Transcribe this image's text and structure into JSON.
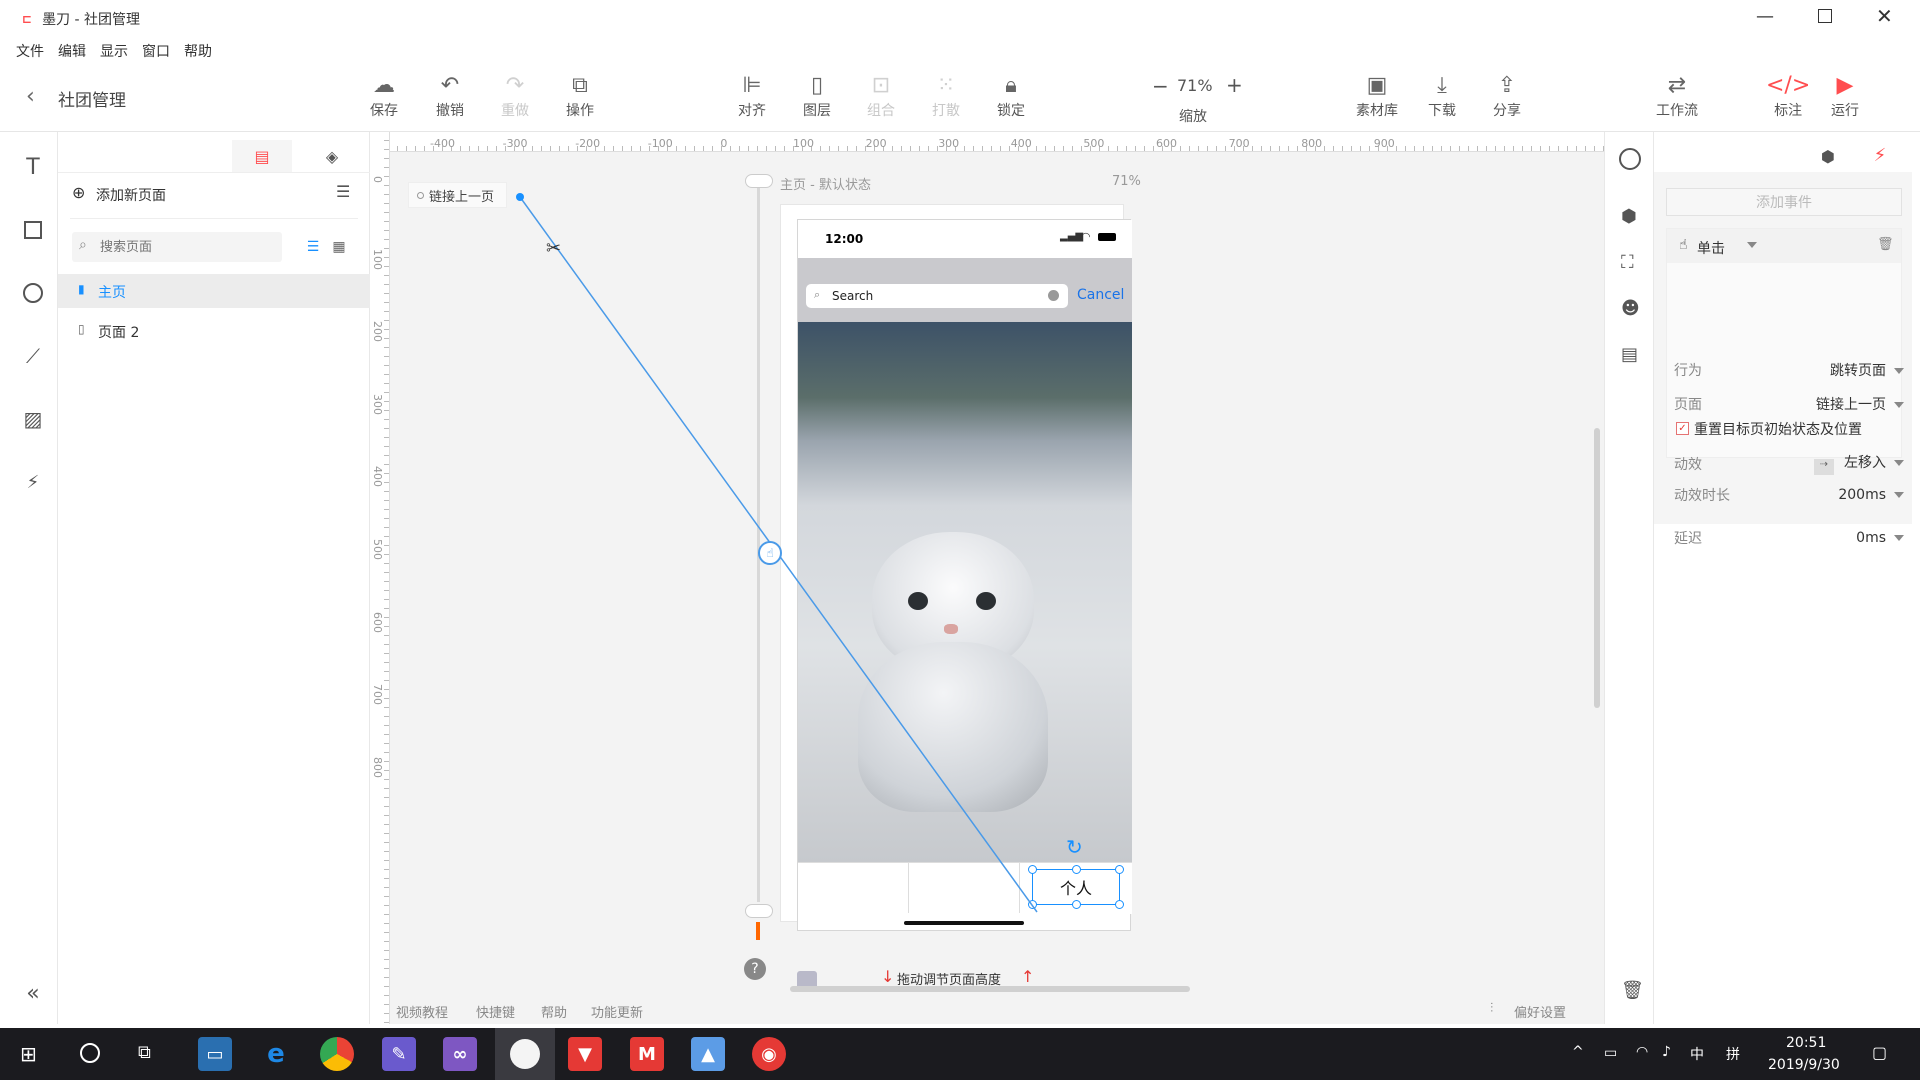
{
  "app": {
    "window_title": "墨刀 - 社团管理",
    "back_label": "社团管理"
  },
  "menu": [
    "文件",
    "编辑",
    "显示",
    "窗口",
    "帮助"
  ],
  "toolbar": {
    "save": "保存",
    "undo": "撤销",
    "redo": "重做",
    "ops": "操作",
    "align": "对齐",
    "layer": "图层",
    "group": "组合",
    "ungroup": "打散",
    "lock": "锁定",
    "zoom_value": "71%",
    "zoom_label": "缩放",
    "zoom_minus": "−",
    "zoom_plus": "+",
    "assets": "素材库",
    "download": "下载",
    "share": "分享",
    "workflow": "工作流",
    "annotate": "标注",
    "run": "运行"
  },
  "pages": {
    "add_label": "添加新页面",
    "search_placeholder": "搜索页面",
    "items": [
      "主页",
      "页面 2"
    ]
  },
  "ruler": {
    "h": [
      "-400",
      "-300",
      "-200",
      "-100",
      "0",
      "100",
      "200",
      "300",
      "400",
      "500",
      "600",
      "700",
      "800",
      "900"
    ],
    "v": [
      "0",
      "100",
      "200",
      "300",
      "400",
      "500",
      "600",
      "700",
      "800"
    ]
  },
  "canvas": {
    "link_tag": "链接上一页",
    "page_caption": "主页 - 默认状态",
    "zoom": "71%",
    "drag_hint": "拖动调节页面高度"
  },
  "phone": {
    "time": "12:00",
    "search_placeholder": "Search",
    "cancel": "Cancel",
    "tab3": "个人"
  },
  "bottom": {
    "links": [
      "视频教程",
      "快捷键",
      "帮助",
      "功能更新"
    ],
    "prefs": "偏好设置"
  },
  "event": {
    "add_event": "添加事件",
    "trigger": "单击",
    "rows": [
      {
        "label": "行为",
        "value": "跳转页面"
      },
      {
        "label": "页面",
        "value": "链接上一页"
      }
    ],
    "checkbox": "重置目标页初始状态及位置",
    "anim_label": "动效",
    "anim_value": "左移入",
    "dur_label": "动效时长",
    "dur_value": "200ms",
    "delay_label": "延迟",
    "delay_value": "0ms"
  },
  "taskbar": {
    "time": "20:51",
    "date": "2019/9/30",
    "ime": "中",
    "ime2": "拼"
  },
  "colors": {
    "accent": "#1890ff",
    "brand": "#ff4d4f",
    "link": "#4a9ae8"
  }
}
